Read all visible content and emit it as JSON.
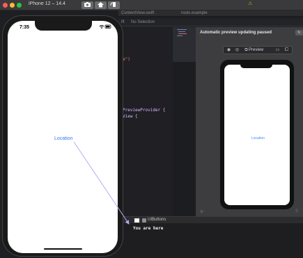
{
  "simulator": {
    "title": "iPhone 12 – 14.4",
    "time": "7:35",
    "location_label": "Location"
  },
  "toolbar": {
    "screenshot_icon": "camera-icon",
    "home_icon": "home-icon",
    "rotate_icon": "rotate-icon",
    "warning": "⚠"
  },
  "tabs": [
    {
      "label": "ContentView.swift"
    },
    {
      "label": "roots.example"
    }
  ],
  "jumpbar": {
    "path": "ift",
    "selection": "No Selection"
  },
  "code_lines": [
    {
      "text": "e\")",
      "color": "#ff8170"
    },
    {
      "text": "PreviewProvider {",
      "color": "#dabaff"
    },
    {
      "text": "View {",
      "color": "#dabaff"
    }
  ],
  "canvas": {
    "status": "Automatic preview updating paused",
    "preview_label": "Preview",
    "mini_location_label": "Location"
  },
  "debug": {
    "scheme_label": "UIButtons"
  },
  "console": {
    "output": "You are here"
  },
  "colors": {
    "accent": "#3478f6",
    "annotation_arrow": "#b7a9f5"
  }
}
